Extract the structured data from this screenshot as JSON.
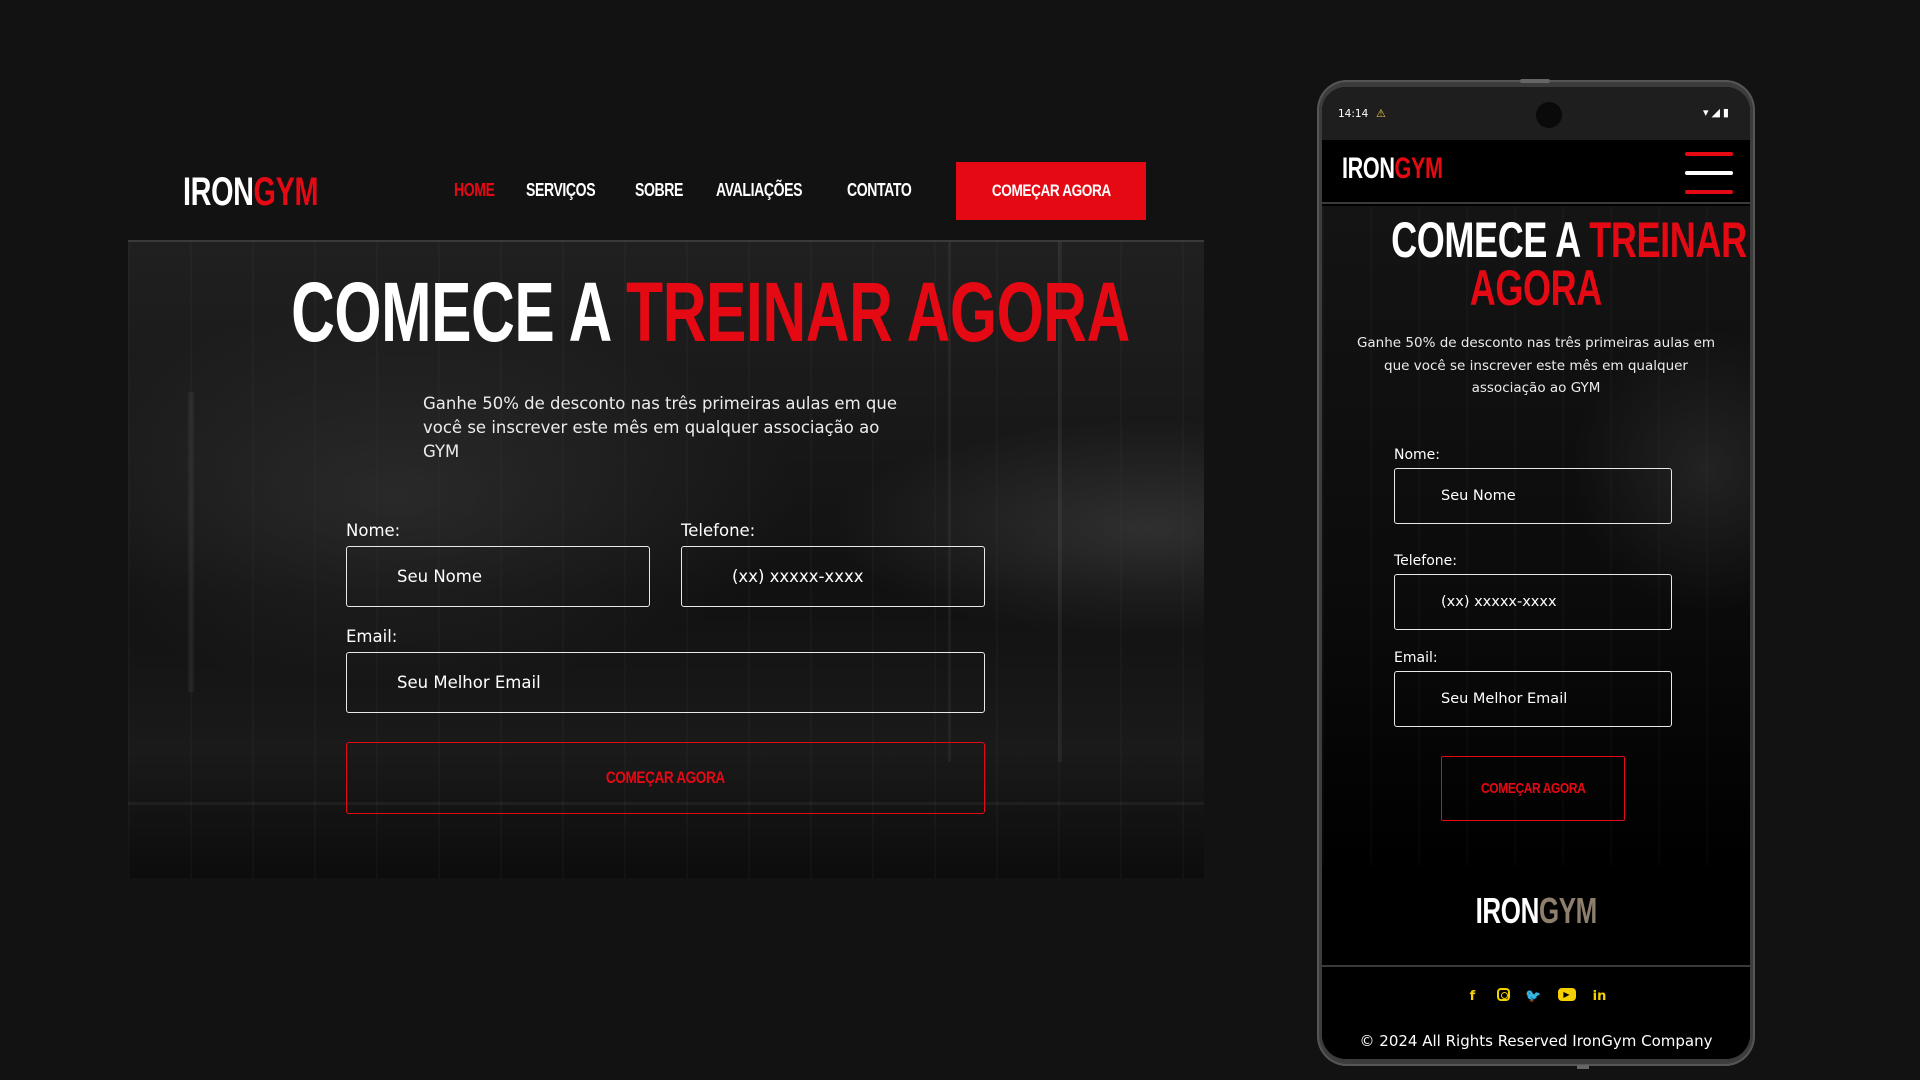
{
  "brand": {
    "iron": "IRON",
    "gym": "GYM"
  },
  "colors": {
    "accent": "#e50914",
    "background": "#121212",
    "social": "#f5d000",
    "footer_gym": "#8d7f6c"
  },
  "desktop": {
    "nav": {
      "items": [
        {
          "label": "HOME",
          "active": true
        },
        {
          "label": "SERVIÇOS"
        },
        {
          "label": "SOBRE"
        },
        {
          "label": "AVALIAÇÕES"
        },
        {
          "label": "CONTATO"
        }
      ],
      "cta": "COMEÇAR AGORA"
    },
    "hero": {
      "title_white": "COMECE A ",
      "title_red": "TREINAR AGORA",
      "subtitle": "Ganhe 50% de desconto nas três primeiras aulas em que você se inscrever este mês em qualquer associação ao GYM"
    },
    "form": {
      "name_label": "Nome:",
      "name_placeholder": "Seu Nome",
      "phone_label": "Telefone:",
      "phone_placeholder": "(xx) xxxxx-xxxx",
      "email_label": "Email:",
      "email_placeholder": "Seu Melhor Email",
      "submit": "COMEÇAR AGORA"
    }
  },
  "mobile": {
    "status": {
      "time": "14:14",
      "warning_icon": "⚠",
      "system_icons": "▾◢▮"
    },
    "hero": {
      "title_white": "COMECE A ",
      "title_red_1": "TREINAR",
      "title_red_2": "AGORA",
      "subtitle": "Ganhe 50% de desconto nas três primeiras aulas em que você se inscrever este mês em qualquer associação ao GYM"
    },
    "form": {
      "name_label": "Nome:",
      "name_placeholder": "Seu Nome",
      "phone_label": "Telefone:",
      "phone_placeholder": "(xx) xxxxx-xxxx",
      "email_label": "Email:",
      "email_placeholder": "Seu Melhor Email",
      "submit": "COMEÇAR AGORA"
    },
    "footer": {
      "social": [
        {
          "name": "facebook-icon",
          "glyph": "f"
        },
        {
          "name": "instagram-icon",
          "glyph": ""
        },
        {
          "name": "twitter-icon",
          "glyph": "🐦"
        },
        {
          "name": "youtube-icon",
          "glyph": "▶"
        },
        {
          "name": "linkedin-icon",
          "glyph": "in"
        }
      ],
      "copyright": "© 2024 All Rights Reserved IronGym Company"
    }
  }
}
